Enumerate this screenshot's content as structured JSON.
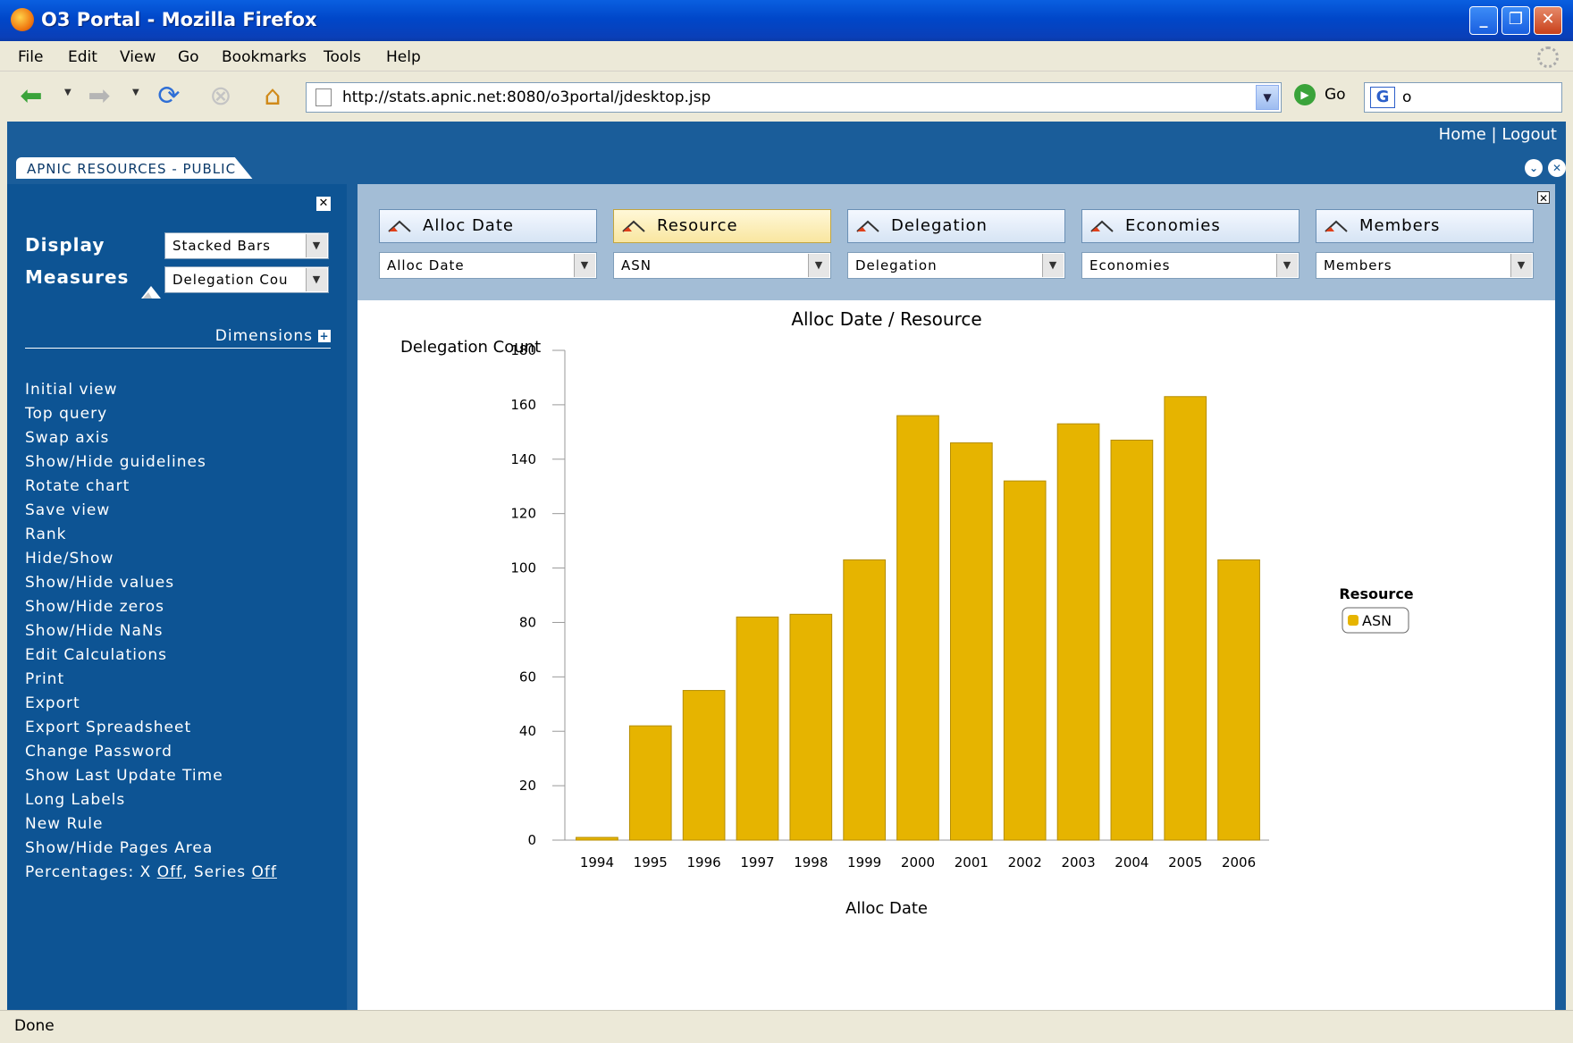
{
  "window": {
    "title": "O3 Portal - Mozilla Firefox"
  },
  "menubar": {
    "items": [
      "File",
      "Edit",
      "View",
      "Go",
      "Bookmarks",
      "Tools",
      "Help"
    ]
  },
  "navbar": {
    "url": "http://stats.apnic.net:8080/o3portal/jdesktop.jsp",
    "go_label": "Go",
    "search_value": "o"
  },
  "portal": {
    "home": "Home",
    "separator": "|",
    "logout": "Logout",
    "tab": "APNIC RESOURCES - PUBLIC"
  },
  "sidebar": {
    "display_label": "Display",
    "display_value": "Stacked Bars",
    "measures_label": "Measures",
    "measures_value": "Delegation Cou",
    "dimensions_label": "Dimensions",
    "menu": [
      "Initial view",
      "Top query",
      "Swap axis",
      "Show/Hide guidelines",
      "Rotate chart",
      "Save view",
      "Rank",
      "Hide/Show",
      "Show/Hide values",
      "Show/Hide zeros",
      "Show/Hide NaNs",
      "Edit Calculations",
      "Print",
      "Export",
      "Export Spreadsheet",
      "Change Password",
      "Show Last Update Time",
      "Long Labels",
      "New Rule",
      "Show/Hide Pages Area"
    ],
    "percentages": {
      "prefix": "Percentages: X",
      "x_value": "Off",
      "middle": ", Series",
      "series_value": "Off"
    }
  },
  "dimensions": [
    {
      "header": "Alloc Date",
      "select": "Alloc Date",
      "active": false
    },
    {
      "header": "Resource",
      "select": "ASN",
      "active": true
    },
    {
      "header": "Delegation",
      "select": "Delegation",
      "active": false
    },
    {
      "header": "Economies",
      "select": "Economies",
      "active": false
    },
    {
      "header": "Members",
      "select": "Members",
      "active": false
    }
  ],
  "colors": {
    "bar": "#e6b400",
    "bar_edge": "#b58d00",
    "accent": "#1a5d9a"
  },
  "chart_data": {
    "type": "bar",
    "title": "Alloc Date / Resource",
    "xlabel": "Alloc Date",
    "ylabel": "Delegation Count",
    "categories": [
      "1994",
      "1995",
      "1996",
      "1997",
      "1998",
      "1999",
      "2000",
      "2001",
      "2002",
      "2003",
      "2004",
      "2005",
      "2006"
    ],
    "series": [
      {
        "name": "ASN",
        "values": [
          1,
          42,
          55,
          82,
          83,
          103,
          156,
          146,
          132,
          153,
          147,
          163,
          103
        ]
      }
    ],
    "ylim": [
      0,
      180
    ],
    "yticks": [
      0,
      20,
      40,
      60,
      80,
      100,
      120,
      140,
      160,
      180
    ],
    "legend": {
      "title": "Resource",
      "position": "right"
    }
  },
  "status": {
    "text": "Done"
  }
}
